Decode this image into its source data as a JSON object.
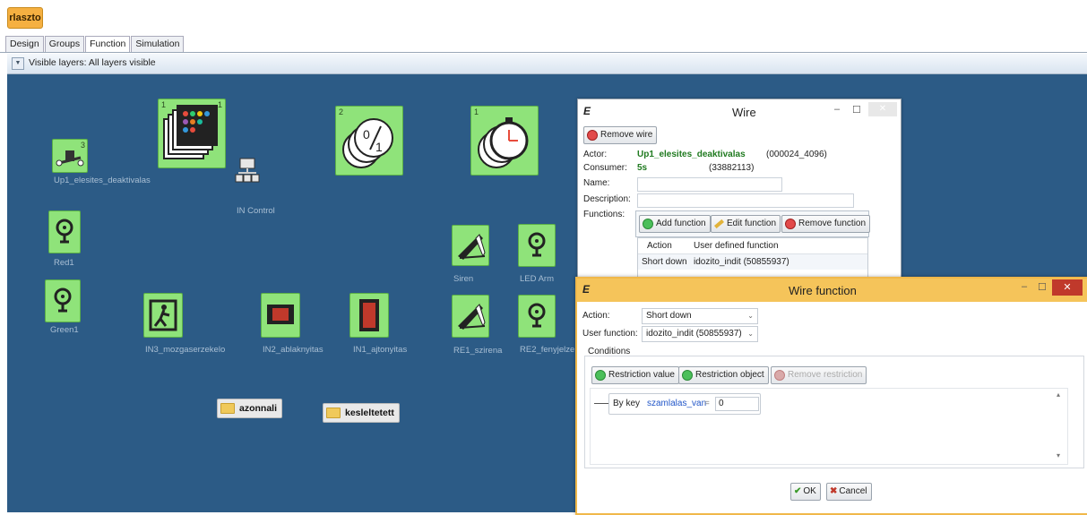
{
  "app_tab": "rlaszto",
  "tabs": [
    "Design",
    "Groups",
    "Function",
    "Simulation"
  ],
  "active_tab": "Function",
  "layers": {
    "text": "Visible layers: All layers visible"
  },
  "canvas": {
    "devices": {
      "up1": {
        "label": "Up1_elesites_deaktivalas",
        "badge": "3"
      },
      "big_list": {
        "badge_left": "1",
        "badge_right": "1"
      },
      "in_control": {
        "label": "IN Control"
      },
      "bool": {
        "badge": "2"
      },
      "timer": {
        "badge": "1"
      },
      "red1": {
        "label": "Red1"
      },
      "green1": {
        "label": "Green1"
      },
      "siren": {
        "label": "Siren"
      },
      "led_arm": {
        "label": "LED Arm"
      },
      "in3": {
        "label": "IN3_mozgaserzekelo"
      },
      "in2": {
        "label": "IN2_ablaknyitas"
      },
      "in1": {
        "label": "IN1_ajtonyitas"
      },
      "re1": {
        "label": "RE1_szirena"
      },
      "re2": {
        "label": "RE2_fenyjelze"
      }
    },
    "folders": [
      "azonnali",
      "kesleltetett"
    ]
  },
  "wire_window": {
    "title": "Wire",
    "remove_wire": "Remove wire",
    "actor_label": "Actor:",
    "actor_name": "Up1_elesites_deaktivalas",
    "actor_id": "(000024_4096)",
    "consumer_label": "Consumer:",
    "consumer_name": "5s",
    "consumer_id": "(33882113)",
    "name_label": "Name:",
    "description_label": "Description:",
    "functions_label": "Functions:",
    "add_function": "Add function",
    "edit_function": "Edit function",
    "remove_function": "Remove function",
    "table_headers": [
      "Action",
      "User defined function"
    ],
    "table_rows": [
      [
        "Short down",
        "idozito_indit (50855937)"
      ]
    ]
  },
  "wire_function_window": {
    "title": "Wire function",
    "action_label": "Action:",
    "action_value": "Short down",
    "user_function_label": "User function:",
    "user_function_value": "idozito_indit (50855937)",
    "conditions_label": "Conditions",
    "restriction_value": "Restriction value",
    "restriction_object": "Restriction object",
    "remove_restriction": "Remove restriction",
    "condition": {
      "by": "By key",
      "key": "szamlalas_van",
      "op": "=",
      "value": "0"
    },
    "ok": "OK",
    "cancel": "Cancel"
  },
  "colors": {
    "canvas": "#2c5b86",
    "device": "#8fe37a",
    "wf_title": "#f5c45a",
    "app_tab": "#f5b041"
  }
}
